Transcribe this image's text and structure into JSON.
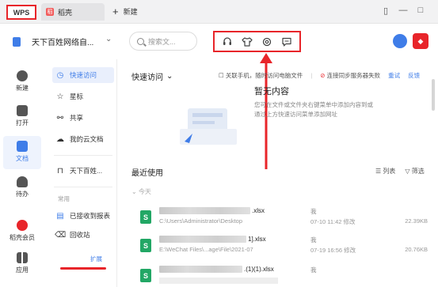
{
  "tabs": {
    "wps_label": "WPS",
    "doc_label": "稻壳",
    "new_label": "新建"
  },
  "header": {
    "workspace_name": "天下百姓网络自...",
    "search_placeholder": "搜索文...",
    "tools": [
      "headset-icon",
      "shirt-icon",
      "gear-icon",
      "chat-icon"
    ]
  },
  "rail": {
    "items": [
      {
        "label": "新建",
        "icon": "plus-circle-icon"
      },
      {
        "label": "打开",
        "icon": "folder-icon"
      },
      {
        "label": "文档",
        "icon": "document-icon"
      },
      {
        "label": "待办",
        "icon": "check-icon"
      },
      {
        "label": "稻壳会员",
        "icon": "member-icon"
      },
      {
        "label": "应用",
        "icon": "apps-icon"
      }
    ]
  },
  "nav": {
    "quick_access": "快速访问",
    "starred": "星标",
    "shared": "共享",
    "cloud_docs": "我的云文档",
    "team": "天下百姓...",
    "common_label": "常用",
    "sent": "已接收到报表",
    "recycle": "回收站",
    "expand": "扩展"
  },
  "main": {
    "quick_access_title": "快速访问",
    "associate_phone": "关联手机，随时访问电脑文件",
    "sync_fail": "连接同步服务器失败",
    "retry": "重试",
    "feedback": "反馈",
    "empty_title": "暂无内容",
    "empty_desc": "您可在文件或文件夹右键菜单中添加内容到或通过上方快速访问菜单添加网址",
    "recent_title": "最近使用",
    "list_label": "列表",
    "filter_label": "筛选",
    "today_label": "今天"
  },
  "files": [
    {
      "name_suffix": ".xlsx",
      "path": "C:\\Users\\Administrator\\Desktop",
      "owner": "我",
      "time": "07-10 11:42 修改",
      "size": "22.39KB"
    },
    {
      "name_suffix": "1].xlsx",
      "path": "E:\\WeChat Files\\...age\\File\\2021-07",
      "owner": "我",
      "time": "07-19 16:56 修改",
      "size": "20.76KB"
    },
    {
      "name_suffix": ".(1)(1).xlsx",
      "path": "",
      "owner": "我",
      "time": "",
      "size": ""
    }
  ]
}
